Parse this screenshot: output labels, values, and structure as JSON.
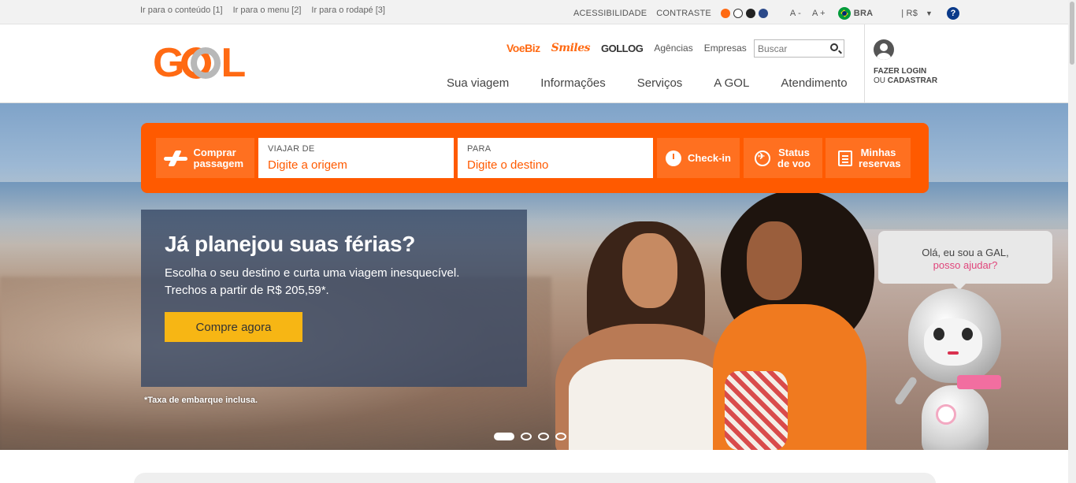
{
  "topbar": {
    "skip_links": [
      "Ir para o conteúdo [1]",
      "Ir para o menu [2]",
      "Ir para o rodapé [3]"
    ],
    "accessibility_label": "ACESSIBILIDADE",
    "contrast_label": "CONTRASTE",
    "contrast_colors": [
      "#ff6a13",
      "#ffffff",
      "#222222",
      "#2c4a8a"
    ],
    "font_decrease": "A -",
    "font_increase": "A +",
    "language": "BRA",
    "currency": "| R$",
    "help": "?"
  },
  "header": {
    "logo_text": "GOL",
    "partners": {
      "voebiz": "VoeBiz",
      "smiles": "Smiles",
      "gollog": "GOLLOG",
      "agencias": "Agências",
      "empresas": "Empresas"
    },
    "search_placeholder": "Buscar",
    "nav": [
      "Sua viagem",
      "Informações",
      "Serviços",
      "A GOL",
      "Atendimento"
    ],
    "login_line1": "FAZER LOGIN",
    "login_line2_prefix": "OU",
    "login_line2_strong": "CADASTRAR"
  },
  "booking": {
    "buy_label": "Comprar passagem",
    "origin_caption": "VIAJAR DE",
    "origin_placeholder": "Digite a origem",
    "dest_caption": "PARA",
    "dest_placeholder": "Digite o destino",
    "checkin_label": "Check-in",
    "status_label": "Status de voo",
    "reservations_label": "Minhas reservas"
  },
  "promo": {
    "title": "Já planejou suas férias?",
    "line1": "Escolha o seu destino e curta uma viagem inesquecível.",
    "line2": "Trechos a partir de R$ 205,59*.",
    "cta": "Compre agora",
    "note": "*Taxa de embarque inclusa."
  },
  "assistant": {
    "greeting": "Olá, eu sou a GAL,",
    "offer": "posso ajudar?"
  },
  "carousel": {
    "slide_count": 4,
    "active_slide": 1
  },
  "colors": {
    "brand_orange": "#ff5a00",
    "cta_yellow": "#f7b614",
    "assistant_pink": "#e0457b"
  }
}
